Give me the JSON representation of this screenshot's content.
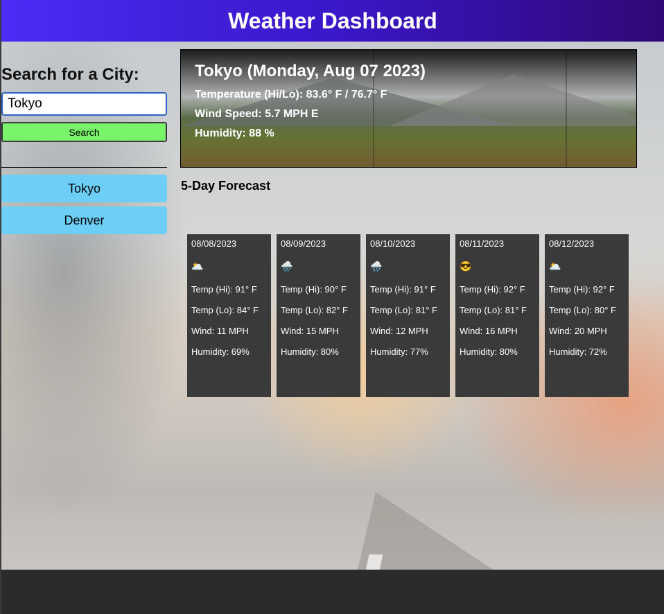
{
  "header": {
    "title": "Weather Dashboard"
  },
  "search": {
    "title": "Search for a City:",
    "input_value": "Tokyo",
    "button_label": "Search"
  },
  "history": [
    {
      "label": "Tokyo"
    },
    {
      "label": "Denver"
    }
  ],
  "current": {
    "title": "Tokyo (Monday, Aug 07 2023)",
    "temperature": "Temperature (Hi/Lo): 83.6° F / 76.7° F",
    "wind": "Wind Speed: 5.7 MPH E",
    "humidity": "Humidity: 88 %"
  },
  "forecast": {
    "title": "5-Day Forecast",
    "days": [
      {
        "date": "08/08/2023",
        "icon": "cloudy-sun-icon",
        "icon_glyph": "🌥️",
        "hi": "Temp (Hi): 91° F",
        "lo": "Temp (Lo): 84° F",
        "wind": "Wind: 11 MPH",
        "humidity": "Humidity: 69%"
      },
      {
        "date": "08/09/2023",
        "icon": "rain-cloud-icon",
        "icon_glyph": "🌧️",
        "hi": "Temp (Hi): 90° F",
        "lo": "Temp (Lo): 82° F",
        "wind": "Wind: 15 MPH",
        "humidity": "Humidity: 80%"
      },
      {
        "date": "08/10/2023",
        "icon": "rain-cloud-icon",
        "icon_glyph": "🌧️",
        "hi": "Temp (Hi): 91° F",
        "lo": "Temp (Lo): 81° F",
        "wind": "Wind: 12 MPH",
        "humidity": "Humidity: 77%"
      },
      {
        "date": "08/11/2023",
        "icon": "sunglasses-face-icon",
        "icon_glyph": "😎",
        "hi": "Temp (Hi): 92° F",
        "lo": "Temp (Lo): 81° F",
        "wind": "Wind: 16 MPH",
        "humidity": "Humidity: 80%"
      },
      {
        "date": "08/12/2023",
        "icon": "cloudy-sun-icon",
        "icon_glyph": "🌥️",
        "hi": "Temp (Hi): 92° F",
        "lo": "Temp (Lo): 80° F",
        "wind": "Wind: 20 MPH",
        "humidity": "Humidity: 72%"
      }
    ]
  },
  "colors": {
    "header_start": "#4a2cf5",
    "header_end": "#300876",
    "search_button": "#79f36a",
    "history_button": "#6dcff6",
    "card_bg": "#3a3a3a",
    "footer": "#2b2b2b"
  }
}
